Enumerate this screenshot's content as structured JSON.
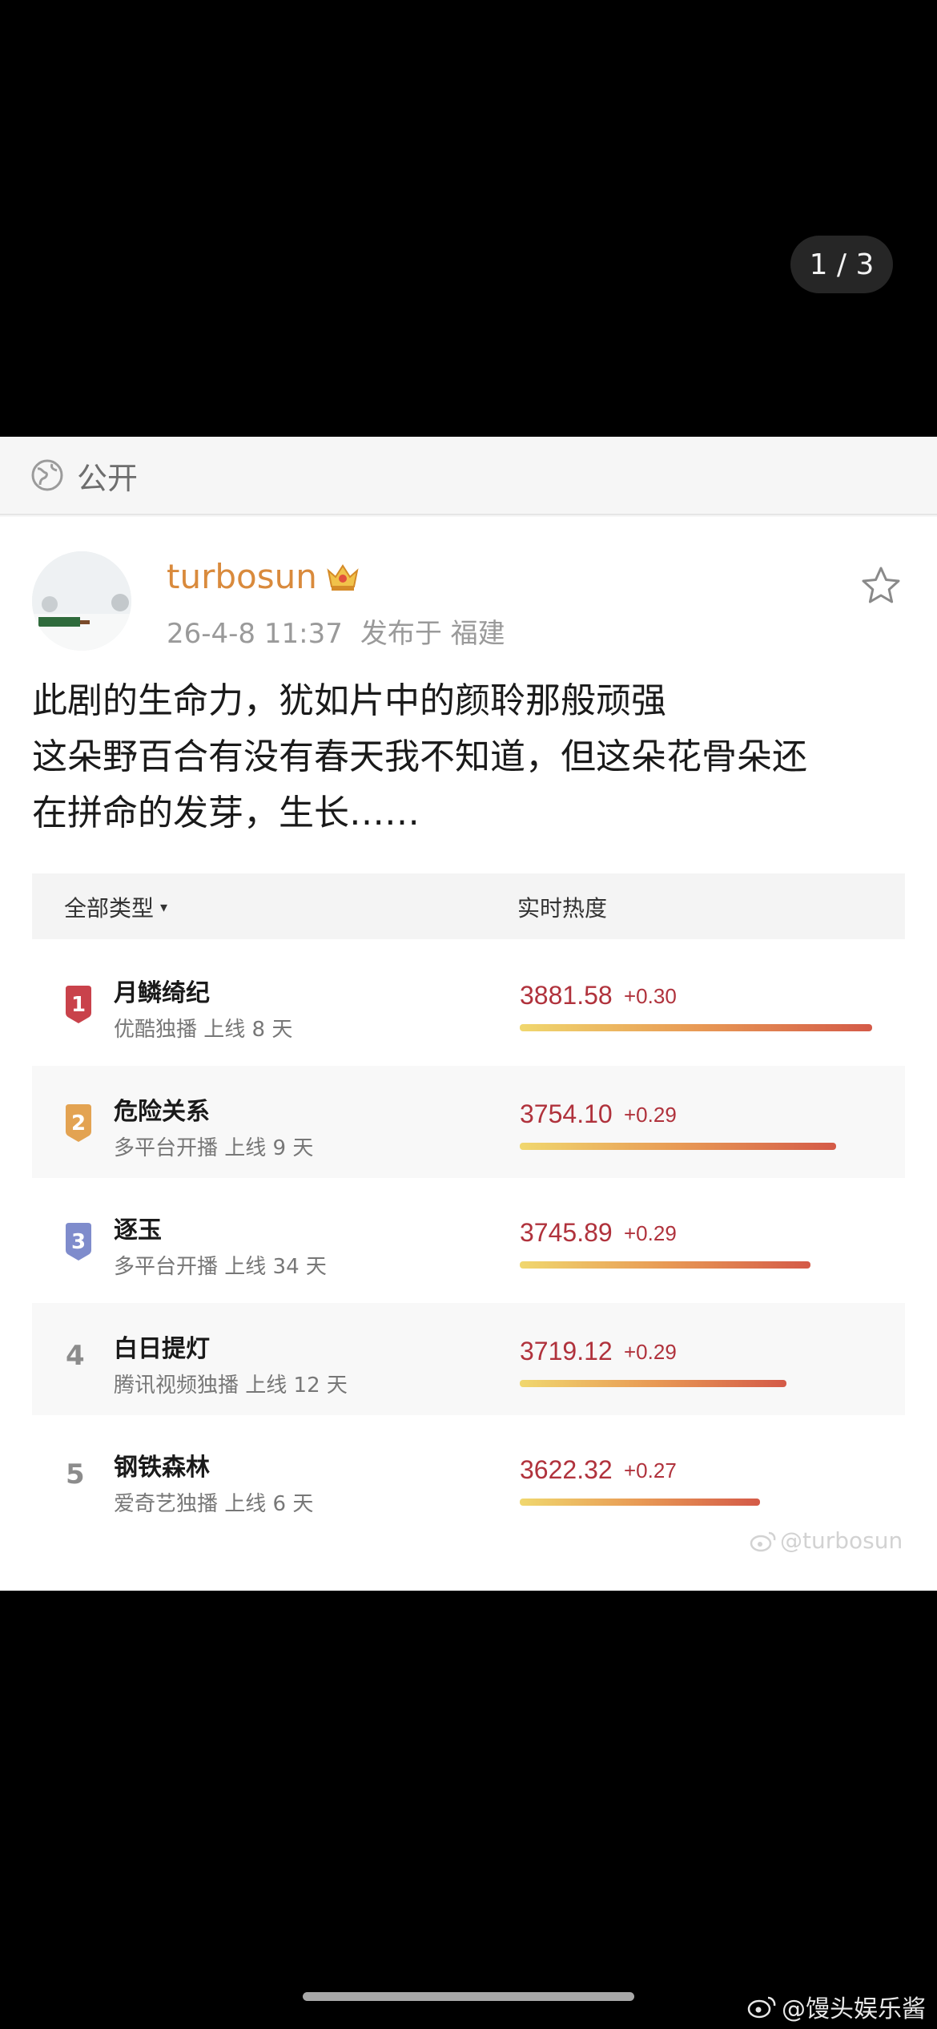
{
  "viewer": {
    "page_counter": "1 / 3"
  },
  "post": {
    "visibility": {
      "label": "公开",
      "icon": "globe-icon"
    },
    "author": {
      "username": "turbosun",
      "badge_icon": "crown-icon"
    },
    "meta": {
      "datetime": "26-4-8 11:37",
      "location": "发布于 福建"
    },
    "favorite_icon": "star-outline-icon",
    "text_lines": [
      "此剧的生命力，犹如片中的颜聆那般顽强",
      "这朵野百合有没有春天我不知道，但这朵花骨朵还",
      "在拼命的发芽，生长……"
    ]
  },
  "ranking": {
    "header": {
      "filter_label": "全部类型",
      "caret": "▾",
      "metric_label": "实时热度"
    },
    "rows": [
      {
        "rank": "1",
        "title": "月鳞绮纪",
        "subtitle": "优酷独播 上线 8 天",
        "score": "3881.58",
        "delta": "+0.30",
        "heat": 3881.58,
        "badge_color": "#c9424b"
      },
      {
        "rank": "2",
        "title": "危险关系",
        "subtitle": "多平台开播 上线 9 天",
        "score": "3754.10",
        "delta": "+0.29",
        "heat": 3754.1,
        "badge_color": "#e3a352"
      },
      {
        "rank": "3",
        "title": "逐玉",
        "subtitle": "多平台开播 上线 34 天",
        "score": "3745.89",
        "delta": "+0.29",
        "heat": 3745.89,
        "badge_color": "#7f8ccc"
      },
      {
        "rank": "4",
        "title": "白日提灯",
        "subtitle": "腾讯视频独播 上线 12 天",
        "score": "3719.12",
        "delta": "+0.29",
        "heat": 3719.12
      },
      {
        "rank": "5",
        "title": "钢铁森林",
        "subtitle": "爱奇艺独播 上线 6 天",
        "score": "3622.32",
        "delta": "+0.27",
        "heat": 3622.32
      }
    ],
    "watermark": "@turbosun"
  },
  "bottom_watermark": "@馒头娱乐酱",
  "colors": {
    "accent_username": "#d98a3c",
    "score_red": "#b0323c"
  }
}
